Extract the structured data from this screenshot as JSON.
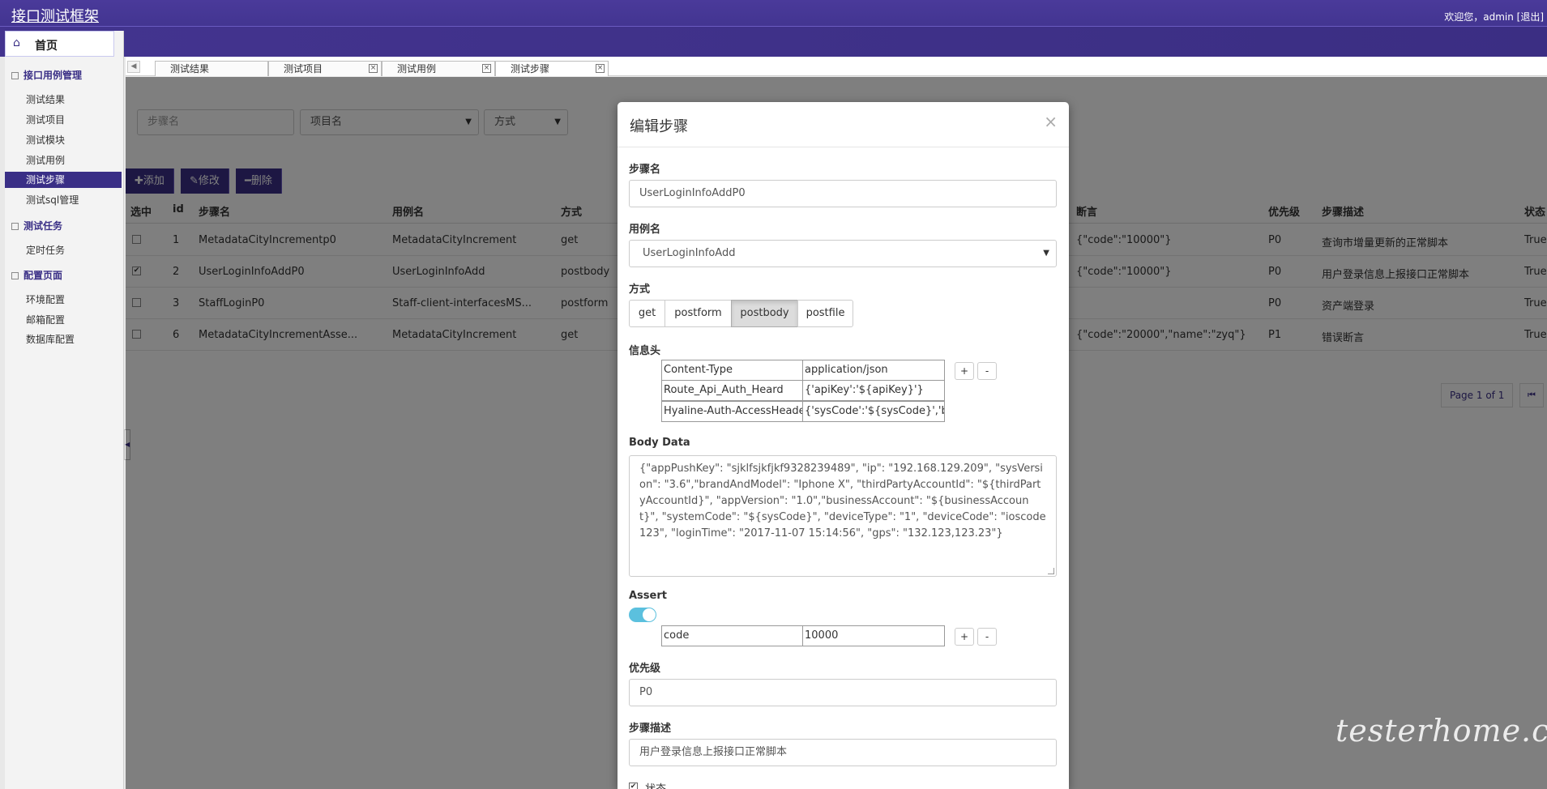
{
  "app": {
    "title": "接口测试框架",
    "welcome": "欢迎您，admin [退出]",
    "home_label": "首页"
  },
  "sidebar": {
    "sections": [
      {
        "title": "接口用例管理",
        "items": [
          "测试结果",
          "测试项目",
          "测试模块",
          "测试用例",
          "测试步骤",
          "测试sql管理"
        ]
      },
      {
        "title": "测试任务",
        "items": [
          "定时任务"
        ]
      },
      {
        "title": "配置页面",
        "items": [
          "环境配置",
          "邮箱配置",
          "数据库配置"
        ]
      }
    ],
    "active_item": "测试步骤"
  },
  "tabs": [
    {
      "label": "测试结果",
      "closable": false
    },
    {
      "label": "测试项目",
      "closable": true
    },
    {
      "label": "测试用例",
      "closable": true
    },
    {
      "label": "测试步骤",
      "closable": true,
      "active": true
    }
  ],
  "filters": {
    "step_name_placeholder": "步骤名",
    "project_placeholder": "项目名",
    "method_placeholder": "方式"
  },
  "toolbar": {
    "add_label": "添加",
    "edit_label": "修改",
    "delete_label": "删除"
  },
  "grid": {
    "columns": [
      "选中",
      "id",
      "步骤名",
      "用例名",
      "方式",
      "断言",
      "优先级",
      "步骤描述",
      "状态"
    ],
    "rows": [
      {
        "checked": false,
        "id": "1",
        "step": "MetadataCityIncrementp0",
        "case": "MetadataCityIncrement",
        "method": "get",
        "assert": "{\"code\":\"10000\"}",
        "priority": "P0",
        "desc": "查询市增量更新的正常脚本",
        "status": "True"
      },
      {
        "checked": true,
        "id": "2",
        "step": "UserLoginInfoAddP0",
        "case": "UserLoginInfoAdd",
        "method": "postbody",
        "assert": "{\"code\":\"10000\"}",
        "priority": "P0",
        "desc": "用户登录信息上报接口正常脚本",
        "status": "True"
      },
      {
        "checked": false,
        "id": "3",
        "step": "StaffLoginP0",
        "case": "Staff-client-interfacesMS...",
        "method": "postform",
        "assert": "",
        "priority": "P0",
        "desc": "资产端登录",
        "status": "True"
      },
      {
        "checked": false,
        "id": "6",
        "step": "MetadataCityIncrementAsse...",
        "case": "MetadataCityIncrement",
        "method": "get",
        "assert": "{\"code\":\"20000\",\"name\":\"zyq\"}",
        "priority": "P1",
        "desc": "错误断言",
        "status": "True"
      }
    ],
    "pager_text": "Page 1 of 1"
  },
  "modal": {
    "title": "编辑步骤",
    "step_name_label": "步骤名",
    "step_name_value": "UserLoginInfoAddP0",
    "case_label": "用例名",
    "case_value": "UserLoginInfoAdd",
    "method_label": "方式",
    "methods": [
      "get",
      "postform",
      "postbody",
      "postfile"
    ],
    "method_selected": "postbody",
    "headers_label": "信息头",
    "headers": [
      {
        "key": "Content-Type",
        "value": "application/json"
      },
      {
        "key": "Route_Api_Auth_Heard",
        "value": "{'apiKey':'${apiKey}'}"
      },
      {
        "key": "Hyaline-Auth-AccessHeade",
        "value": "{'sysCode':'${sysCode}','biz"
      }
    ],
    "body_label": "Body Data",
    "body_value": "{\"appPushKey\": \"sjklfsjkfjkf9328239489\", \"ip\": \"192.168.129.209\", \"sysVersion\": \"3.6\",\"brandAndModel\": \"Iphone X\", \"thirdPartyAccountId\": \"${thirdPartyAccountId}\", \"appVersion\": \"1.0\",\"businessAccount\": \"${businessAccount}\", \"systemCode\": \"${sysCode}\", \"deviceType\": \"1\", \"deviceCode\": \"ioscode123\", \"loginTime\": \"2017-11-07 15:14:56\", \"gps\": \"132.123,123.23\"}",
    "assert_label": "Assert",
    "assert_enabled": true,
    "assert_key": "code",
    "assert_value": "10000",
    "plus": "+",
    "minus": "-",
    "priority_label": "优先级",
    "priority_value": "P0",
    "desc_label": "步骤描述",
    "desc_value": "用户登录信息上报接口正常脚本",
    "status_label": "状态",
    "status_checked": true,
    "close_symbol": "×"
  },
  "watermark": "testerhome.com",
  "colors": {
    "brand": "#3a2f86",
    "toggle_on": "#5bc0de"
  }
}
